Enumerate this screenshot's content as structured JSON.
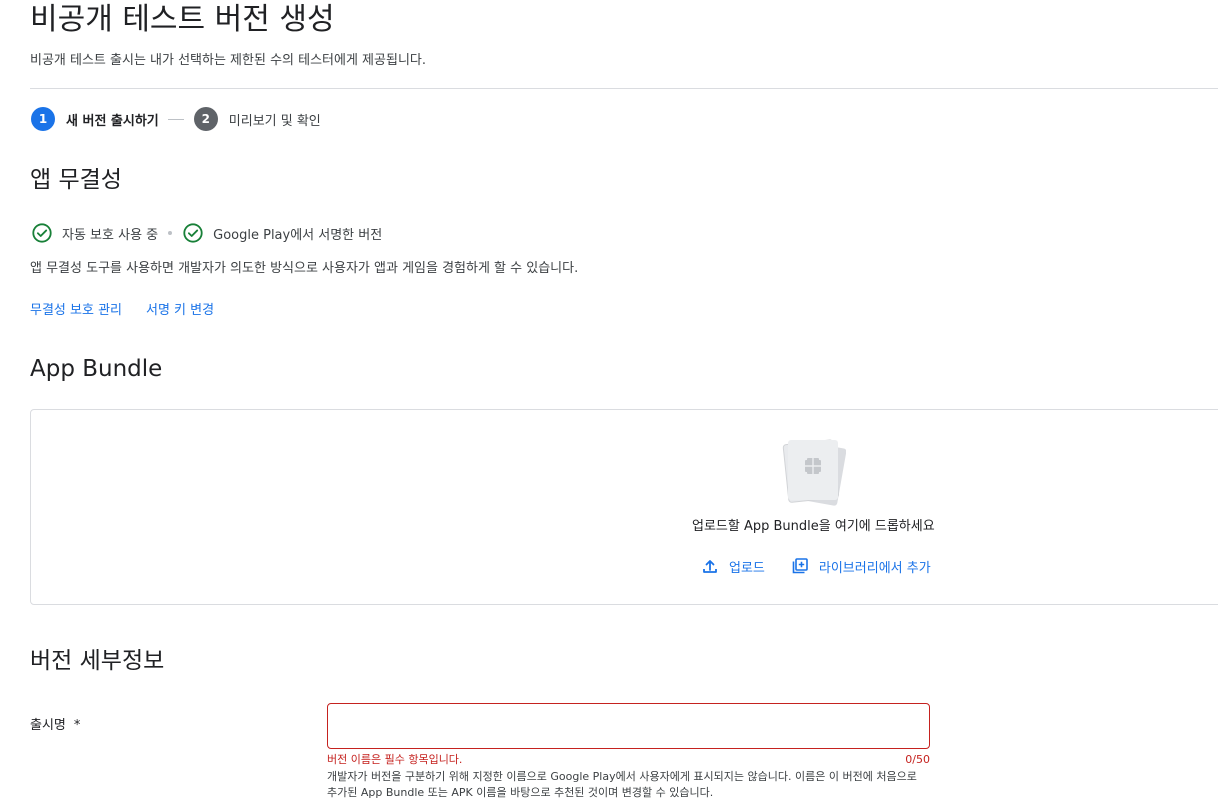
{
  "page": {
    "title": "비공개 테스트 버전 생성",
    "subtitle": "비공개 테스트 출시는 내가 선택하는 제한된 수의 테스터에게 제공됩니다."
  },
  "stepper": {
    "steps": [
      {
        "number": "1",
        "label": "새 버전 출시하기",
        "state": "active"
      },
      {
        "number": "2",
        "label": "미리보기 및 확인",
        "state": "inactive"
      }
    ]
  },
  "app_integrity": {
    "title": "앱 무결성",
    "status_items": [
      {
        "icon": "check-circle-icon",
        "label": "자동 보호 사용 중"
      },
      {
        "icon": "check-circle-icon",
        "label": "Google Play에서 서명한 버전"
      }
    ],
    "description": "앱 무결성 도구를 사용하면 개발자가 의도한 방식으로 사용자가 앱과 게임을 경험하게 할 수 있습니다.",
    "links": [
      "무결성 보호 관리",
      "서명 키 변경"
    ]
  },
  "app_bundle": {
    "title": "App Bundle",
    "drop_text": "업로드할 App Bundle을 여기에 드롭하세요",
    "upload_label": "업로드",
    "library_label": "라이브러리에서 추가"
  },
  "release_details": {
    "title": "버전 세부정보",
    "name_label": "출시명",
    "required_mark": "*",
    "name_value": "",
    "name_error": "버전 이름은 필수 항목입니다.",
    "name_counter": "0/50",
    "name_helper": "개발자가 버전을 구분하기 위해 지정한 이름으로 Google Play에서 사용자에게 표시되지는 않습니다. 이름은 이 버전에 처음으로 추가된 App Bundle 또는 APK 이름을 바탕으로 추천된 것이며 변경할 수 있습니다."
  },
  "colors": {
    "accent": "#1a73e8",
    "success": "#188038",
    "error": "#c5221f"
  }
}
